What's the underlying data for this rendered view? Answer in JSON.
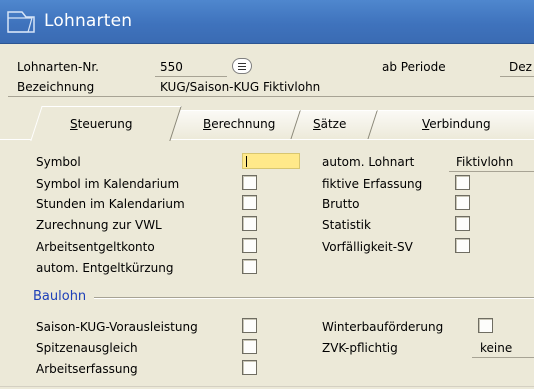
{
  "window": {
    "title": "Lohnarten"
  },
  "header": {
    "lohnart_nr_label": "Lohnarten-Nr.",
    "lohnart_nr_value": "550",
    "ab_periode_label": "ab Periode",
    "ab_periode_value": "Dez",
    "bezeichnung_label": "Bezeichnung",
    "bezeichnung_value": "KUG/Saison-KUG Fiktivlohn"
  },
  "tabs": [
    {
      "label": "Steuerung",
      "active": true
    },
    {
      "label": "Berechnung",
      "active": false
    },
    {
      "label": "Sätze",
      "active": false
    },
    {
      "label": "Verbindung",
      "active": false
    }
  ],
  "steuerung": {
    "symbol_label": "Symbol",
    "symbol_value": "",
    "left_checks": [
      {
        "label": "Symbol im Kalendarium",
        "checked": false
      },
      {
        "label": "Stunden im Kalendarium",
        "checked": false
      },
      {
        "label": "Zurechnung zur VWL",
        "checked": false
      },
      {
        "label": "Arbeitsentgeltkonto",
        "checked": false
      },
      {
        "label": "autom. Entgeltkürzung",
        "checked": false
      }
    ],
    "autom_lohnart_label": "autom. Lohnart",
    "autom_lohnart_value": "Fiktivlohn",
    "right_checks": [
      {
        "label": "fiktive Erfassung",
        "checked": false
      },
      {
        "label": "Brutto",
        "checked": false
      },
      {
        "label": "Statistik",
        "checked": false
      },
      {
        "label": "Vorfälligkeit-SV",
        "checked": false
      }
    ]
  },
  "baulohn": {
    "title": "Baulohn",
    "left_checks": [
      {
        "label": "Saison-KUG-Vorausleistung",
        "checked": false
      },
      {
        "label": "Spitzenausgleich",
        "checked": false
      },
      {
        "label": "Arbeitserfassung",
        "checked": false
      }
    ],
    "winterbau_label": "Winterbauförderung",
    "zvk_label": "ZVK-pflichtig",
    "zvk_value": "keine"
  }
}
